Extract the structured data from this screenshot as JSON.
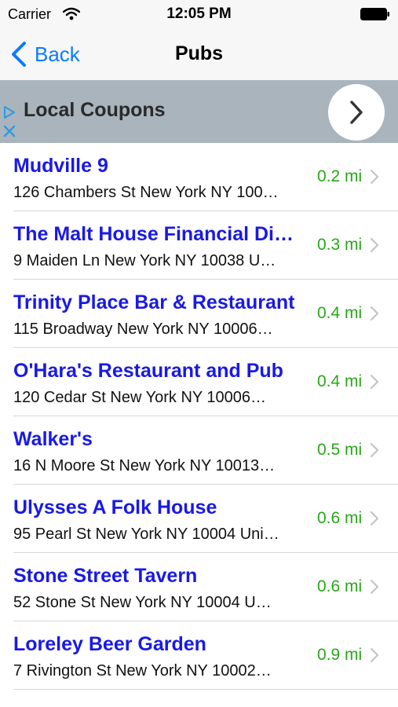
{
  "status_bar": {
    "carrier": "Carrier",
    "time": "12:05 PM"
  },
  "nav": {
    "back_label": "Back",
    "title": "Pubs"
  },
  "ad": {
    "title": "Local Coupons"
  },
  "colors": {
    "accent": "#0a7bff",
    "place_name": "#1919e6",
    "distance": "#2aa61a",
    "ad_background": "#a9b4bd"
  },
  "pubs": [
    {
      "name": "Mudville 9",
      "address": "126 Chambers St New York NY 100…",
      "distance": "0.2 mi"
    },
    {
      "name": "The Malt House Financial Di…",
      "address": "9 Maiden Ln New York NY 10038 U…",
      "distance": "0.3 mi"
    },
    {
      "name": "Trinity Place Bar & Restaurant",
      "address": "115 Broadway New York NY 10006…",
      "distance": "0.4 mi"
    },
    {
      "name": "O'Hara's Restaurant and Pub",
      "address": "120 Cedar St New York NY 10006…",
      "distance": "0.4 mi"
    },
    {
      "name": "Walker's",
      "address": "16 N Moore St New York NY 10013…",
      "distance": "0.5 mi"
    },
    {
      "name": "Ulysses A Folk House",
      "address": "95 Pearl St New York NY 10004 Uni…",
      "distance": "0.6 mi"
    },
    {
      "name": "Stone Street Tavern",
      "address": "52 Stone St New York NY 10004 U…",
      "distance": "0.6 mi"
    },
    {
      "name": "Loreley Beer Garden",
      "address": "7 Rivington St New York NY 10002…",
      "distance": "0.9 mi"
    }
  ]
}
